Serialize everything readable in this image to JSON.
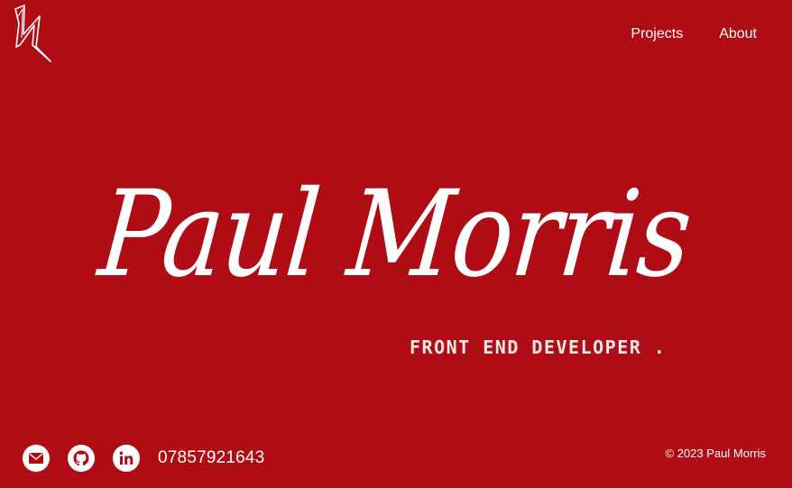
{
  "nav": {
    "projects_label": "Projects",
    "about_label": "About"
  },
  "hero": {
    "name": "Paul Morris",
    "subtitle": "FRONT END DEVELOPER ."
  },
  "footer": {
    "social_icons": [
      "email-icon",
      "github-icon",
      "linkedin-icon"
    ],
    "phone": "07857921643",
    "copyright": "© 2023 Paul Morris"
  },
  "colors": {
    "background": "#b00c15",
    "text": "#ffffff"
  }
}
